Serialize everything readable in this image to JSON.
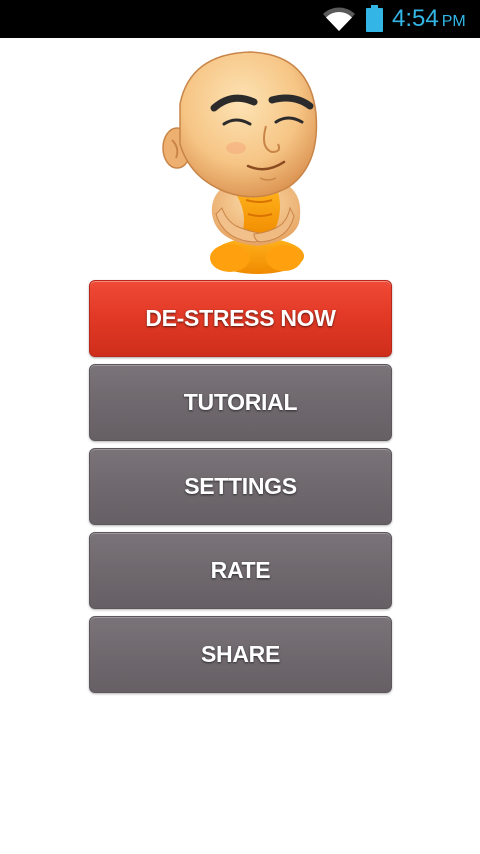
{
  "status_bar": {
    "time": "4:54",
    "ampm": "PM",
    "icons": [
      "wifi-icon",
      "battery-icon"
    ],
    "accent_color": "#33b5e5"
  },
  "mascot": {
    "icon": "meditating-monk-mascot"
  },
  "menu": {
    "buttons": [
      {
        "label": "DE-STRESS NOW",
        "style": "primary",
        "color": "#e23a26"
      },
      {
        "label": "TUTORIAL",
        "style": "secondary",
        "color": "#6f696e"
      },
      {
        "label": "SETTINGS",
        "style": "secondary",
        "color": "#6f696e"
      },
      {
        "label": "RATE",
        "style": "secondary",
        "color": "#6f696e"
      },
      {
        "label": "SHARE",
        "style": "secondary",
        "color": "#6f696e"
      }
    ]
  }
}
